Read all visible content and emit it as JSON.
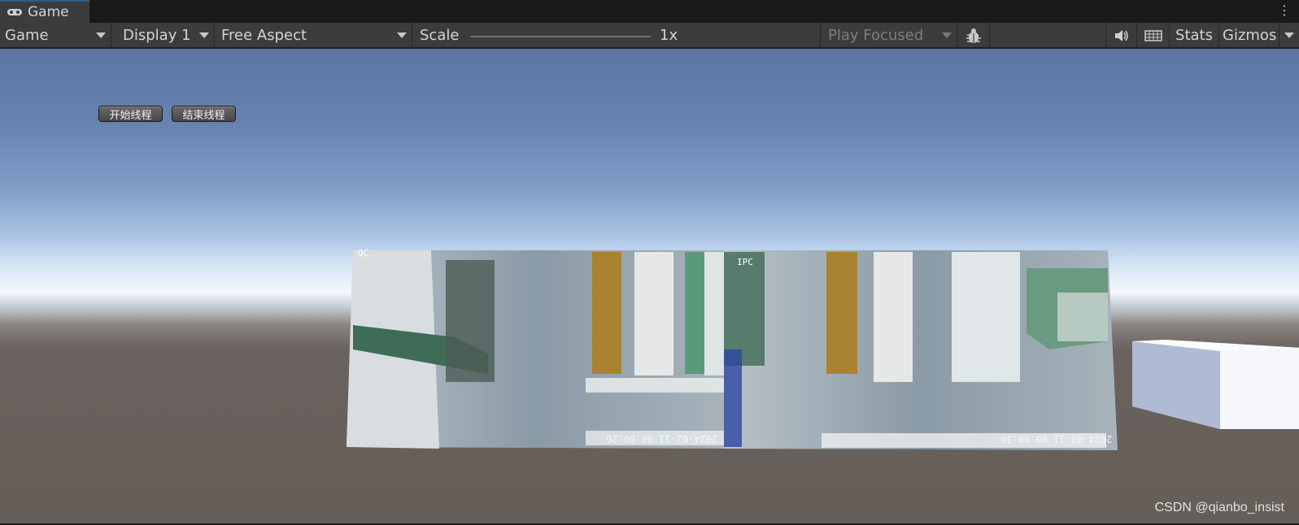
{
  "window": {
    "tab_title": "Game",
    "tab_icon": "gamepad-icon",
    "menu_icon": "kebab-icon"
  },
  "toolbar": {
    "view_dropdown": "Game",
    "display_dropdown": "Display 1",
    "aspect_dropdown": "Free Aspect",
    "scale_label": "Scale",
    "scale_value": "1x",
    "play_mode_dropdown": "Play Focused",
    "debug_icon": "bug-icon",
    "audio_icon": "speaker-icon",
    "keyboard_icon": "keyboard-icon",
    "stats_label": "Stats",
    "gizmos_label": "Gizmos"
  },
  "game_view": {
    "start_thread_button": "开始线程",
    "stop_thread_button": "结束线程",
    "camera_left_label": "QC",
    "camera_right_label": "IPC",
    "timestamp_left": "2024-02-11 00:00:26",
    "timestamp_right": "2024-02-11 00:00:36",
    "watermark": "CSDN @qianbo_insist"
  },
  "colors": {
    "toolbar_bg": "#3c3c3c",
    "tab_accent": "#2c5d87",
    "sky_top": "#5b75a1",
    "ground": "#655e58"
  }
}
